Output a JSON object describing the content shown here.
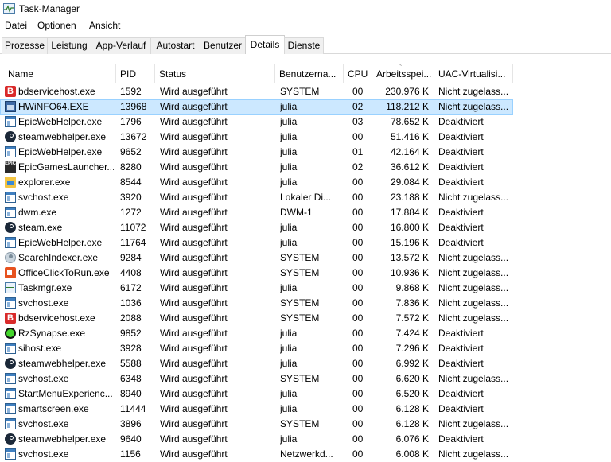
{
  "window": {
    "title": "Task-Manager"
  },
  "menu": [
    "Datei",
    "Optionen",
    "Ansicht"
  ],
  "tabs": [
    {
      "label": "Prozesse",
      "active": false
    },
    {
      "label": "Leistung",
      "active": false
    },
    {
      "label": "App-Verlauf",
      "active": false
    },
    {
      "label": "Autostart",
      "active": false
    },
    {
      "label": "Benutzer",
      "active": false
    },
    {
      "label": "Details",
      "active": true
    },
    {
      "label": "Dienste",
      "active": false
    }
  ],
  "columns": [
    "Name",
    "PID",
    "Status",
    "Benutzerna...",
    "CPU",
    "Arbeitsspei...",
    "UAC-Virtualisi..."
  ],
  "sort_indicator": "^",
  "rows": [
    {
      "icon": "bitdefender-icon",
      "name": "bdservicehost.exe",
      "pid": "1592",
      "status": "Wird ausgeführt",
      "user": "SYSTEM",
      "cpu": "00",
      "mem": "230.976 K",
      "uac": "Nicht zugelass...",
      "selected": false
    },
    {
      "icon": "hwinfo-icon",
      "name": "HWiNFO64.EXE",
      "pid": "13968",
      "status": "Wird ausgeführt",
      "user": "julia",
      "cpu": "02",
      "mem": "118.212 K",
      "uac": "Nicht zugelass...",
      "selected": true
    },
    {
      "icon": "window-app-icon",
      "name": "EpicWebHelper.exe",
      "pid": "1796",
      "status": "Wird ausgeführt",
      "user": "julia",
      "cpu": "03",
      "mem": "78.652 K",
      "uac": "Deaktiviert",
      "selected": false
    },
    {
      "icon": "steam-icon",
      "name": "steamwebhelper.exe",
      "pid": "13672",
      "status": "Wird ausgeführt",
      "user": "julia",
      "cpu": "00",
      "mem": "51.416 K",
      "uac": "Deaktiviert",
      "selected": false
    },
    {
      "icon": "window-app-icon",
      "name": "EpicWebHelper.exe",
      "pid": "9652",
      "status": "Wird ausgeführt",
      "user": "julia",
      "cpu": "01",
      "mem": "42.164 K",
      "uac": "Deaktiviert",
      "selected": false
    },
    {
      "icon": "epic-games-icon",
      "name": "EpicGamesLauncher....",
      "pid": "8280",
      "status": "Wird ausgeführt",
      "user": "julia",
      "cpu": "02",
      "mem": "36.612 K",
      "uac": "Deaktiviert",
      "selected": false
    },
    {
      "icon": "explorer-folder-icon",
      "name": "explorer.exe",
      "pid": "8544",
      "status": "Wird ausgeführt",
      "user": "julia",
      "cpu": "00",
      "mem": "29.084 K",
      "uac": "Deaktiviert",
      "selected": false
    },
    {
      "icon": "window-app-icon",
      "name": "svchost.exe",
      "pid": "3920",
      "status": "Wird ausgeführt",
      "user": "Lokaler Di...",
      "cpu": "00",
      "mem": "23.188 K",
      "uac": "Nicht zugelass...",
      "selected": false
    },
    {
      "icon": "window-app-icon",
      "name": "dwm.exe",
      "pid": "1272",
      "status": "Wird ausgeführt",
      "user": "DWM-1",
      "cpu": "00",
      "mem": "17.884 K",
      "uac": "Deaktiviert",
      "selected": false
    },
    {
      "icon": "steam-icon",
      "name": "steam.exe",
      "pid": "11072",
      "status": "Wird ausgeführt",
      "user": "julia",
      "cpu": "00",
      "mem": "16.800 K",
      "uac": "Deaktiviert",
      "selected": false
    },
    {
      "icon": "window-app-icon",
      "name": "EpicWebHelper.exe",
      "pid": "11764",
      "status": "Wird ausgeführt",
      "user": "julia",
      "cpu": "00",
      "mem": "15.196 K",
      "uac": "Deaktiviert",
      "selected": false
    },
    {
      "icon": "search-indexer-icon",
      "name": "SearchIndexer.exe",
      "pid": "9284",
      "status": "Wird ausgeführt",
      "user": "SYSTEM",
      "cpu": "00",
      "mem": "13.572 K",
      "uac": "Nicht zugelass...",
      "selected": false
    },
    {
      "icon": "office-icon",
      "name": "OfficeClickToRun.exe",
      "pid": "4408",
      "status": "Wird ausgeführt",
      "user": "SYSTEM",
      "cpu": "00",
      "mem": "10.936 K",
      "uac": "Nicht zugelass...",
      "selected": false
    },
    {
      "icon": "task-manager-icon",
      "name": "Taskmgr.exe",
      "pid": "6172",
      "status": "Wird ausgeführt",
      "user": "julia",
      "cpu": "00",
      "mem": "9.868 K",
      "uac": "Nicht zugelass...",
      "selected": false
    },
    {
      "icon": "window-app-icon",
      "name": "svchost.exe",
      "pid": "1036",
      "status": "Wird ausgeführt",
      "user": "SYSTEM",
      "cpu": "00",
      "mem": "7.836 K",
      "uac": "Nicht zugelass...",
      "selected": false
    },
    {
      "icon": "bitdefender-icon",
      "name": "bdservicehost.exe",
      "pid": "2088",
      "status": "Wird ausgeführt",
      "user": "SYSTEM",
      "cpu": "00",
      "mem": "7.572 K",
      "uac": "Nicht zugelass...",
      "selected": false
    },
    {
      "icon": "razer-icon",
      "name": "RzSynapse.exe",
      "pid": "9852",
      "status": "Wird ausgeführt",
      "user": "julia",
      "cpu": "00",
      "mem": "7.424 K",
      "uac": "Deaktiviert",
      "selected": false
    },
    {
      "icon": "window-app-icon",
      "name": "sihost.exe",
      "pid": "3928",
      "status": "Wird ausgeführt",
      "user": "julia",
      "cpu": "00",
      "mem": "7.296 K",
      "uac": "Deaktiviert",
      "selected": false
    },
    {
      "icon": "steam-icon",
      "name": "steamwebhelper.exe",
      "pid": "5588",
      "status": "Wird ausgeführt",
      "user": "julia",
      "cpu": "00",
      "mem": "6.992 K",
      "uac": "Deaktiviert",
      "selected": false
    },
    {
      "icon": "window-app-icon",
      "name": "svchost.exe",
      "pid": "6348",
      "status": "Wird ausgeführt",
      "user": "SYSTEM",
      "cpu": "00",
      "mem": "6.620 K",
      "uac": "Nicht zugelass...",
      "selected": false
    },
    {
      "icon": "window-app-icon",
      "name": "StartMenuExperienc...",
      "pid": "8940",
      "status": "Wird ausgeführt",
      "user": "julia",
      "cpu": "00",
      "mem": "6.520 K",
      "uac": "Deaktiviert",
      "selected": false
    },
    {
      "icon": "window-app-icon",
      "name": "smartscreen.exe",
      "pid": "11444",
      "status": "Wird ausgeführt",
      "user": "julia",
      "cpu": "00",
      "mem": "6.128 K",
      "uac": "Deaktiviert",
      "selected": false
    },
    {
      "icon": "window-app-icon",
      "name": "svchost.exe",
      "pid": "3896",
      "status": "Wird ausgeführt",
      "user": "SYSTEM",
      "cpu": "00",
      "mem": "6.128 K",
      "uac": "Nicht zugelass...",
      "selected": false
    },
    {
      "icon": "steam-icon",
      "name": "steamwebhelper.exe",
      "pid": "9640",
      "status": "Wird ausgeführt",
      "user": "julia",
      "cpu": "00",
      "mem": "6.076 K",
      "uac": "Deaktiviert",
      "selected": false
    },
    {
      "icon": "window-app-icon",
      "name": "svchost.exe",
      "pid": "1156",
      "status": "Wird ausgeführt",
      "user": "Netzwerkd...",
      "cpu": "00",
      "mem": "6.008 K",
      "uac": "Nicht zugelass...",
      "selected": false
    }
  ]
}
